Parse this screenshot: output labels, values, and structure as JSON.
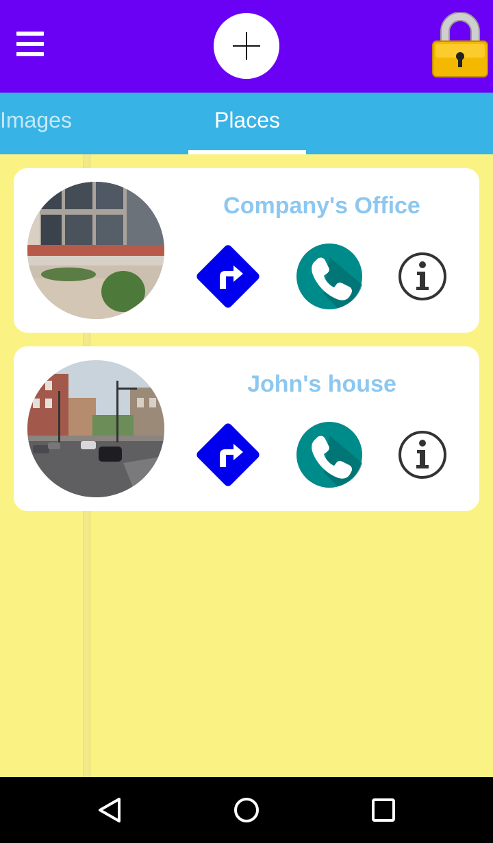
{
  "header": {
    "menu_icon": "hamburger-menu-icon",
    "add_icon": "plus-icon",
    "lock_icon": "padlock-icon"
  },
  "tabs": [
    {
      "label": "Images",
      "active": false
    },
    {
      "label": "Places",
      "active": true
    }
  ],
  "places": [
    {
      "name": "Company's Office",
      "photo": "office-building-photo",
      "actions": [
        "directions-icon",
        "phone-icon",
        "info-icon"
      ]
    },
    {
      "name": "John's house",
      "photo": "street-intersection-photo",
      "actions": [
        "directions-icon",
        "phone-icon",
        "info-icon"
      ]
    }
  ],
  "system_nav": [
    "back-icon",
    "home-icon",
    "recents-icon"
  ],
  "colors": {
    "header_bg": "#6a00f4",
    "tabs_bg": "#37b3e6",
    "map_bg": "#faf383",
    "title_text": "#8cc7f0",
    "directions_blue": "#0000ee",
    "call_teal": "#008b8b"
  }
}
